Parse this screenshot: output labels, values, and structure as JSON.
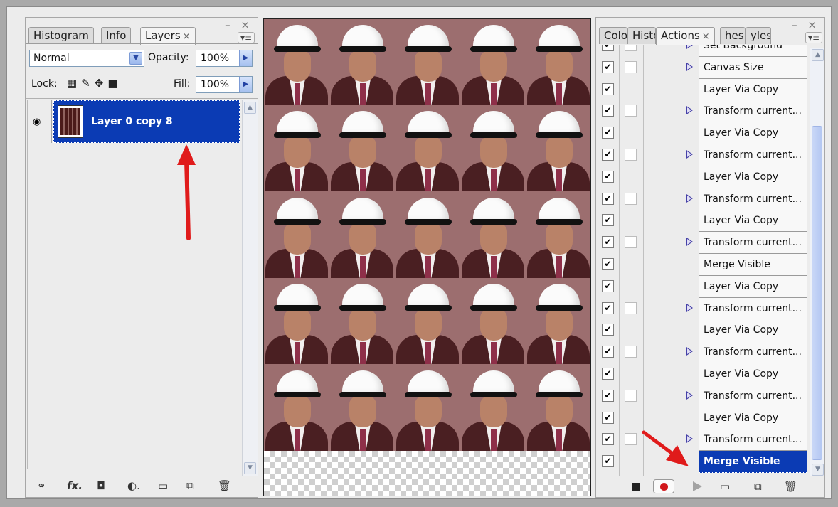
{
  "layers_panel": {
    "tabs": [
      {
        "label": "Histogram",
        "active": false
      },
      {
        "label": "Info",
        "active": false
      },
      {
        "label": "Layers",
        "active": true,
        "close": "×"
      }
    ],
    "window_controls": "– ×",
    "blend_mode": "Normal",
    "opacity_label": "Opacity:",
    "opacity_value": "100%",
    "lock_label": "Lock:",
    "fill_label": "Fill:",
    "fill_value": "100%",
    "layer": {
      "name": "Layer 0 copy 8",
      "visible": true,
      "selected": true
    },
    "bottom_icons": [
      "link-icon",
      "fx-icon",
      "mask-icon",
      "adjustment-icon",
      "group-icon",
      "new-layer-icon",
      "trash-icon"
    ]
  },
  "canvas": {
    "grid_columns": 5,
    "grid_rows": 5,
    "background_color": "#9c6e6f"
  },
  "actions_panel": {
    "tabs": [
      {
        "label": "Colo",
        "active": false
      },
      {
        "label": "Histo",
        "active": false
      },
      {
        "label": "Actions",
        "active": true,
        "close": "×"
      },
      {
        "label": "hes",
        "active": false
      },
      {
        "label": "yles",
        "active": false
      }
    ],
    "window_controls": "– ×",
    "items": [
      {
        "label": "Set Background",
        "checked": true,
        "dialog_box": true,
        "expandable": true,
        "selected": false
      },
      {
        "label": "Canvas Size",
        "checked": true,
        "dialog_box": true,
        "expandable": true,
        "selected": false
      },
      {
        "label": "Layer Via Copy",
        "checked": true,
        "dialog_box": false,
        "expandable": false,
        "selected": false
      },
      {
        "label": "Transform current...",
        "checked": true,
        "dialog_box": true,
        "expandable": true,
        "selected": false
      },
      {
        "label": "Layer Via Copy",
        "checked": true,
        "dialog_box": false,
        "expandable": false,
        "selected": false
      },
      {
        "label": "Transform current...",
        "checked": true,
        "dialog_box": true,
        "expandable": true,
        "selected": false
      },
      {
        "label": "Layer Via Copy",
        "checked": true,
        "dialog_box": false,
        "expandable": false,
        "selected": false
      },
      {
        "label": "Transform current...",
        "checked": true,
        "dialog_box": true,
        "expandable": true,
        "selected": false
      },
      {
        "label": "Layer Via Copy",
        "checked": true,
        "dialog_box": false,
        "expandable": false,
        "selected": false
      },
      {
        "label": "Transform current...",
        "checked": true,
        "dialog_box": true,
        "expandable": true,
        "selected": false
      },
      {
        "label": "Merge Visible",
        "checked": true,
        "dialog_box": false,
        "expandable": false,
        "selected": false
      },
      {
        "label": "Layer Via Copy",
        "checked": true,
        "dialog_box": false,
        "expandable": false,
        "selected": false
      },
      {
        "label": "Transform current...",
        "checked": true,
        "dialog_box": true,
        "expandable": true,
        "selected": false
      },
      {
        "label": "Layer Via Copy",
        "checked": true,
        "dialog_box": false,
        "expandable": false,
        "selected": false
      },
      {
        "label": "Transform current...",
        "checked": true,
        "dialog_box": true,
        "expandable": true,
        "selected": false
      },
      {
        "label": "Layer Via Copy",
        "checked": true,
        "dialog_box": false,
        "expandable": false,
        "selected": false
      },
      {
        "label": "Transform current...",
        "checked": true,
        "dialog_box": true,
        "expandable": true,
        "selected": false
      },
      {
        "label": "Layer Via Copy",
        "checked": true,
        "dialog_box": false,
        "expandable": false,
        "selected": false
      },
      {
        "label": "Transform current...",
        "checked": true,
        "dialog_box": true,
        "expandable": true,
        "selected": false
      },
      {
        "label": "Merge Visible",
        "checked": true,
        "dialog_box": false,
        "expandable": false,
        "selected": true
      }
    ],
    "bottom_icons": [
      "stop-icon",
      "record-icon",
      "play-icon",
      "folder-icon",
      "new-action-icon",
      "trash-icon"
    ]
  },
  "colors": {
    "selection_blue": "#0b3bb4",
    "annotation_arrow": "#e01b1b",
    "record_red": "#d0161a"
  }
}
